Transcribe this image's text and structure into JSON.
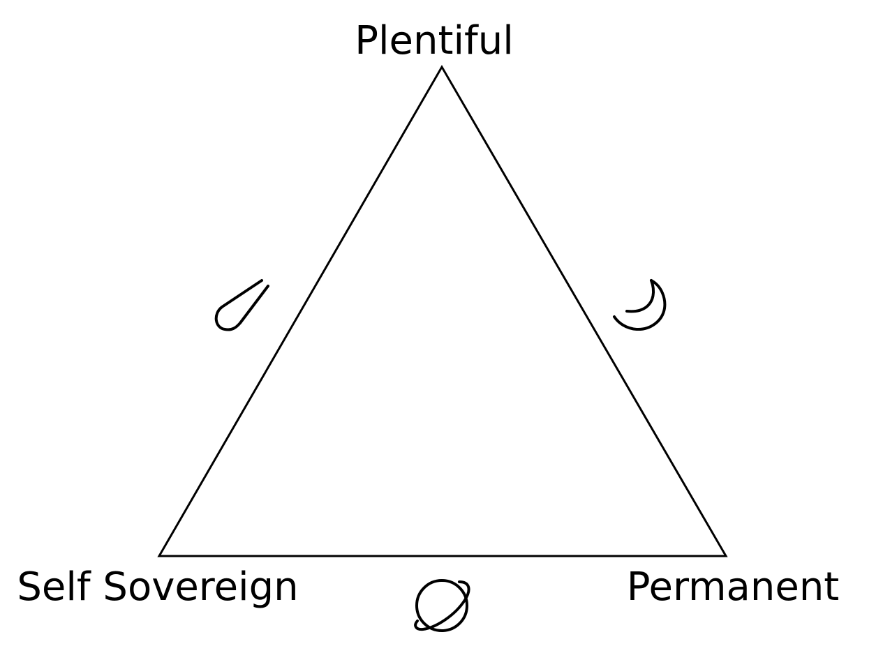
{
  "diagram": {
    "vertices": {
      "top": "Plentiful",
      "bottom_left": "Self Sovereign",
      "bottom_right": "Permanent"
    },
    "edge_icons": {
      "left": "comet-icon",
      "right": "crescent-moon-icon",
      "bottom": "planet-icon"
    },
    "stroke_color": "#000000",
    "background_color": "#ffffff"
  }
}
